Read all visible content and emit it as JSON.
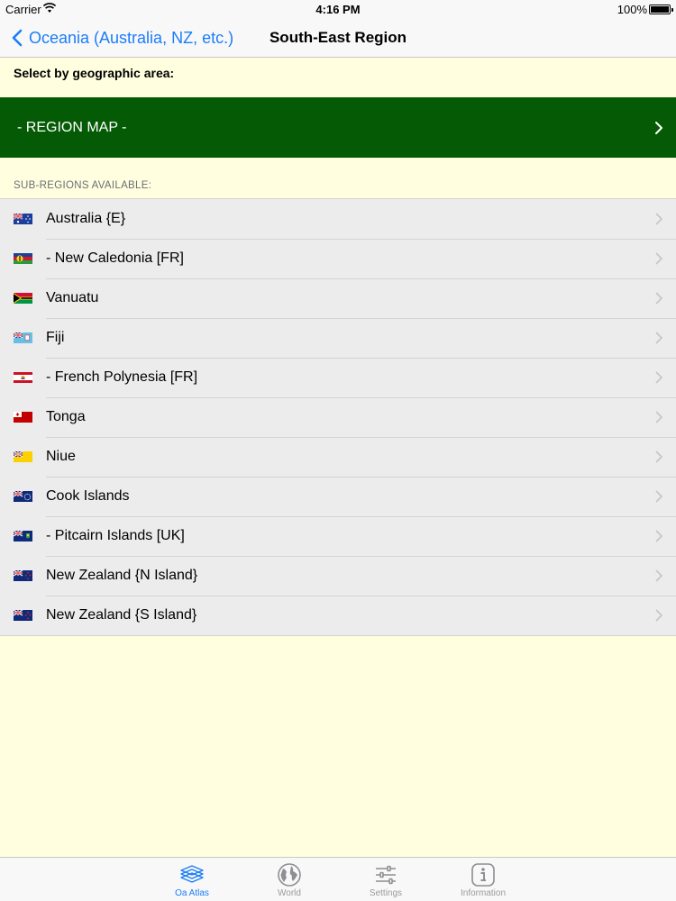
{
  "status_bar": {
    "carrier": "Carrier",
    "time": "4:16 PM",
    "battery": "100%"
  },
  "nav": {
    "back_label": "Oceania (Australia, NZ, etc.)",
    "title": "South-East Region"
  },
  "select_label": "Select by geographic area:",
  "region_map": {
    "label": "- REGION MAP -",
    "color": "#055b05"
  },
  "section_header": "SUB-REGIONS AVAILABLE:",
  "sub_regions": [
    {
      "name": "Australia {E}",
      "flag_icon": "australia-flag-icon"
    },
    {
      "name": "- New Caledonia [FR]",
      "flag_icon": "new-caledonia-flag-icon"
    },
    {
      "name": "Vanuatu",
      "flag_icon": "vanuatu-flag-icon"
    },
    {
      "name": "Fiji",
      "flag_icon": "fiji-flag-icon"
    },
    {
      "name": "- French Polynesia [FR]",
      "flag_icon": "french-polynesia-flag-icon"
    },
    {
      "name": "Tonga",
      "flag_icon": "tonga-flag-icon"
    },
    {
      "name": "Niue",
      "flag_icon": "niue-flag-icon"
    },
    {
      "name": "Cook Islands",
      "flag_icon": "cook-islands-flag-icon"
    },
    {
      "name": "- Pitcairn Islands [UK]",
      "flag_icon": "pitcairn-islands-flag-icon"
    },
    {
      "name": "New Zealand {N Island}",
      "flag_icon": "new-zealand-flag-icon"
    },
    {
      "name": "New Zealand {S Island}",
      "flag_icon": "new-zealand-flag-icon"
    }
  ],
  "tabs": [
    {
      "label": "Oa Atlas",
      "icon": "atlas-icon",
      "active": true
    },
    {
      "label": "World",
      "icon": "globe-icon",
      "active": false
    },
    {
      "label": "Settings",
      "icon": "sliders-icon",
      "active": false
    },
    {
      "label": "Information",
      "icon": "info-icon",
      "active": false
    }
  ],
  "colors": {
    "accent": "#1a7dfa",
    "background": "#ffffe0"
  }
}
